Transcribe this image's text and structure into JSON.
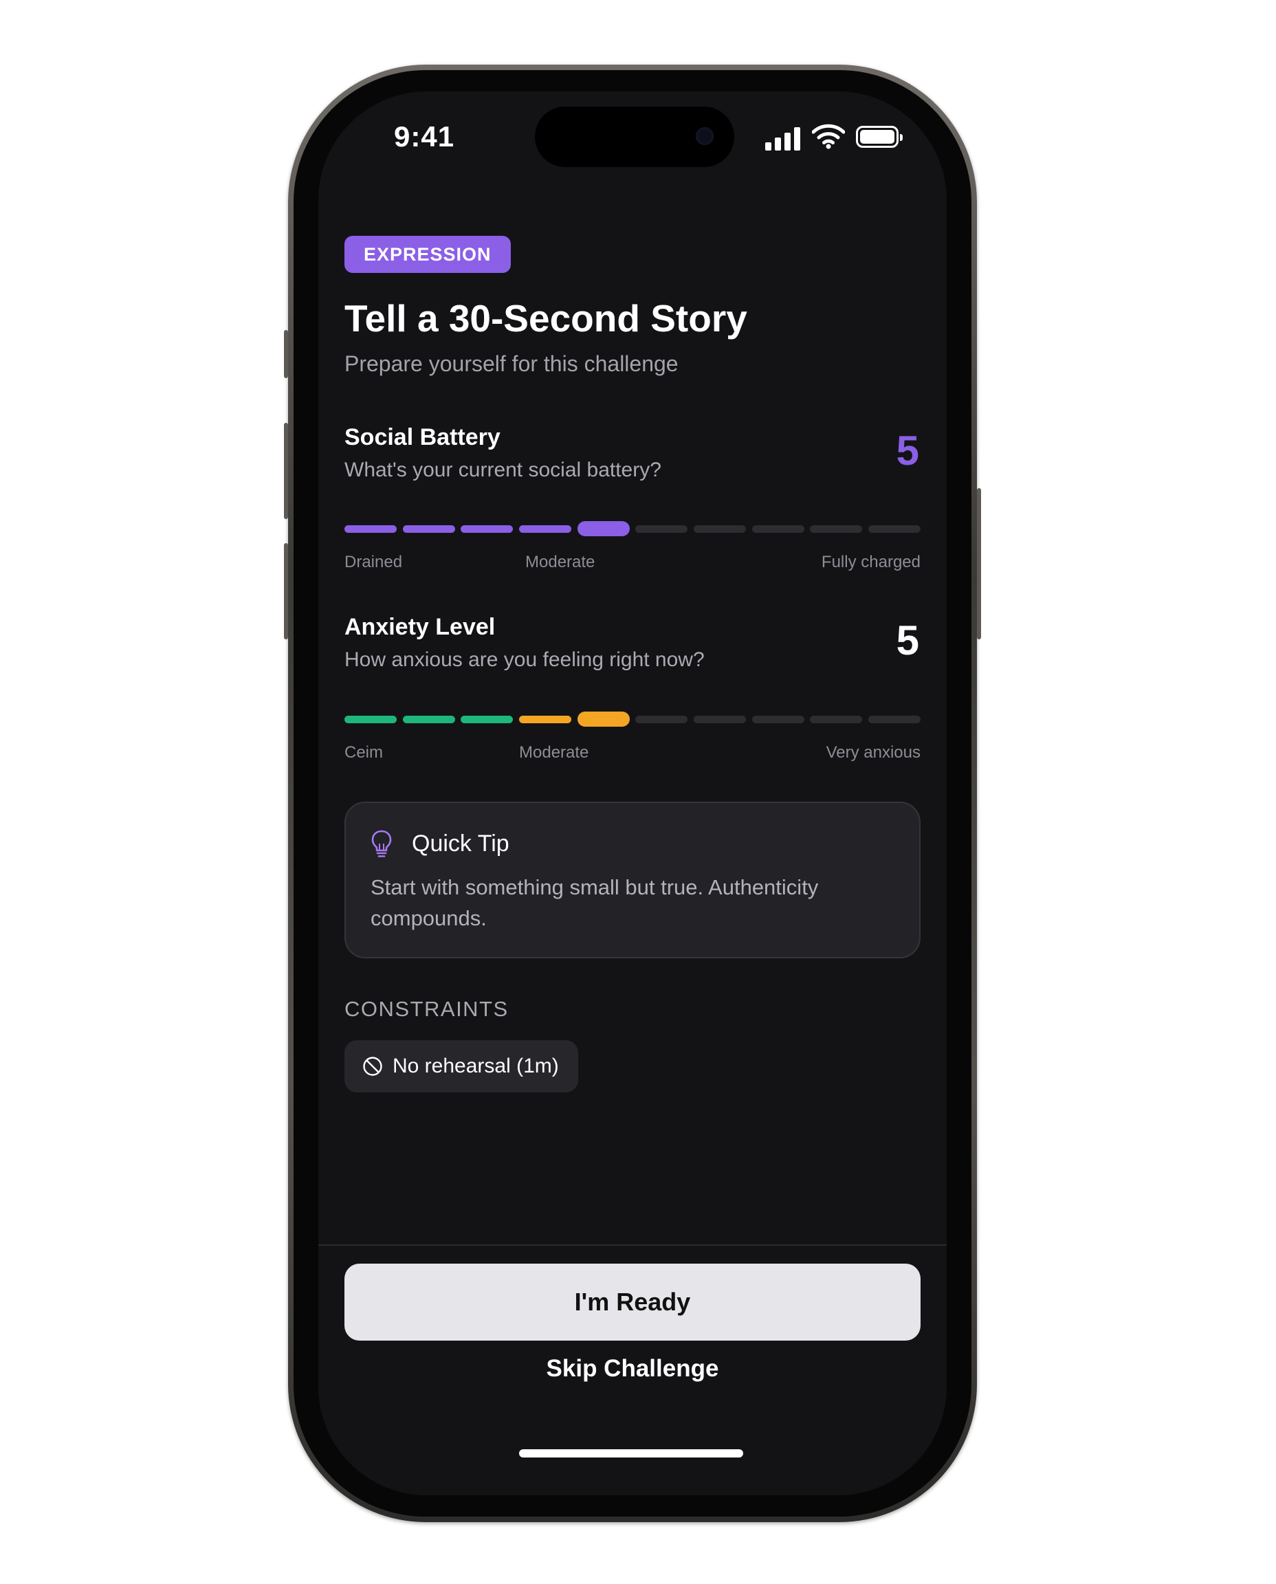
{
  "status_bar": {
    "time": "9:41"
  },
  "challenge": {
    "category": "EXPRESSION",
    "title": "Tell a 30-Second Story",
    "subtitle": "Prepare yourself for this challenge"
  },
  "social_battery": {
    "title": "Social Battery",
    "question": "What's your current social battery?",
    "value": "5",
    "selected_level": 5,
    "max_level": 10,
    "scale_labels": {
      "low": "Drained",
      "mid": "Moderate",
      "high": "Fully charged"
    },
    "colors": {
      "accent": "#8b5fe6",
      "inactive": "#2c2c31"
    }
  },
  "anxiety": {
    "title": "Anxiety Level",
    "question": "How anxious are you feeling right now?",
    "value": "5",
    "selected_level": 5,
    "max_level": 10,
    "scale_labels": {
      "low": "Ceim",
      "mid": "Moderate",
      "high": "Very anxious"
    },
    "colors": {
      "calm": "#1fb67c",
      "moderate": "#f5a524",
      "inactive": "#2c2c31"
    }
  },
  "tip": {
    "icon": "lightbulb-icon",
    "title": "Quick Tip",
    "text": "Start with something small but true. Authenticity compounds."
  },
  "constraints": {
    "heading": "CONSTRAINTS",
    "items": [
      {
        "icon": "prohibited-icon",
        "label": "No rehearsal (1m)"
      }
    ]
  },
  "actions": {
    "primary_label": "I'm Ready",
    "secondary_label": "Skip Challenge"
  }
}
